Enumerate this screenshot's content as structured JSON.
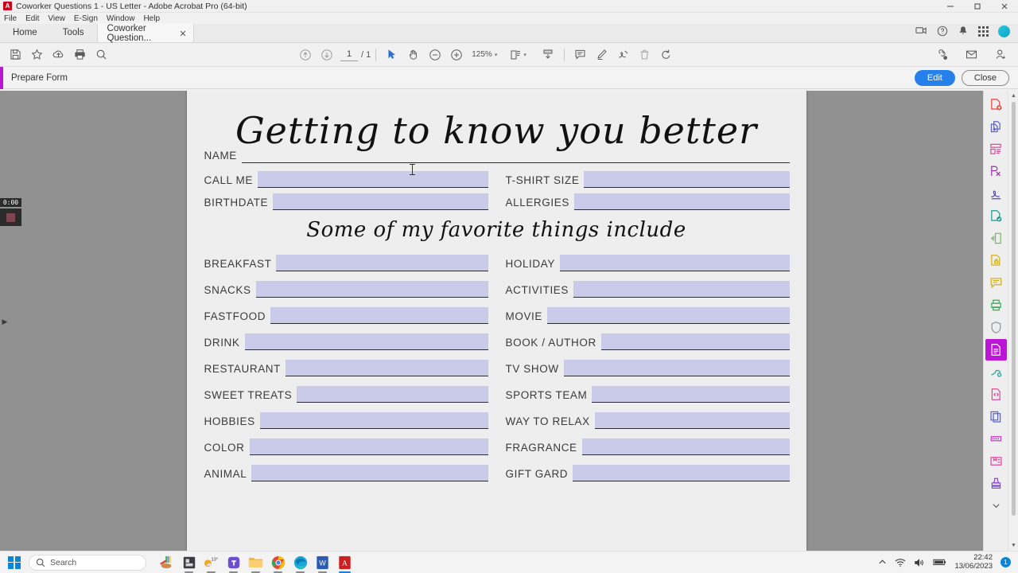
{
  "window": {
    "title": "Coworker Questions 1 - US Letter - Adobe Acrobat Pro (64-bit)",
    "app_logo": "A",
    "minimize": "—",
    "maximize": "❐",
    "close": "✕"
  },
  "menubar": {
    "items": [
      "File",
      "Edit",
      "View",
      "E-Sign",
      "Window",
      "Help"
    ]
  },
  "tabstrip": {
    "home": "Home",
    "tools": "Tools",
    "document_tab": "Coworker Question...",
    "tab_close": "✕"
  },
  "toolbar": {
    "page_current": "1",
    "page_total": "/ 1",
    "zoom_level": "125%",
    "zoom_caret": "▾"
  },
  "prepare_form": {
    "title": "Prepare Form",
    "edit_label": "Edit",
    "close_label": "Close"
  },
  "document": {
    "title": "Getting to know you better",
    "subtitle": "Some of my favorite things include",
    "name_label": "NAME",
    "top_rows": [
      {
        "left_label": "CALL ME",
        "right_label": "T-SHIRT SIZE"
      },
      {
        "left_label": "BIRTHDATE",
        "right_label": "ALLERGIES"
      }
    ],
    "favorite_rows": [
      {
        "left_label": "BREAKFAST",
        "right_label": "HOLIDAY"
      },
      {
        "left_label": "SNACKS",
        "right_label": "ACTIVITIES"
      },
      {
        "left_label": "FASTFOOD",
        "right_label": "MOVIE"
      },
      {
        "left_label": "DRINK",
        "right_label": "BOOK / AUTHOR"
      },
      {
        "left_label": "RESTAURANT",
        "right_label": "TV SHOW"
      },
      {
        "left_label": "SWEET TREATS",
        "right_label": "SPORTS TEAM"
      },
      {
        "left_label": "HOBBIES",
        "right_label": "WAY TO RELAX"
      },
      {
        "left_label": "COLOR",
        "right_label": "FRAGRANCE"
      },
      {
        "left_label": "ANIMAL",
        "right_label": "GIFT GARD"
      }
    ],
    "field_fill_color": "#c9cbe8"
  },
  "recorder": {
    "time": "0:00"
  },
  "taskbar": {
    "search_placeholder": "Search",
    "weather_temp": "13°",
    "clock_time": "22:42",
    "clock_date": "13/06/2023",
    "notification_count": "1"
  },
  "colors": {
    "accent_purple": "#bb16d4",
    "edit_blue": "#2680eb",
    "canvas_gray": "#919191",
    "page_bg": "#eeeeee"
  }
}
